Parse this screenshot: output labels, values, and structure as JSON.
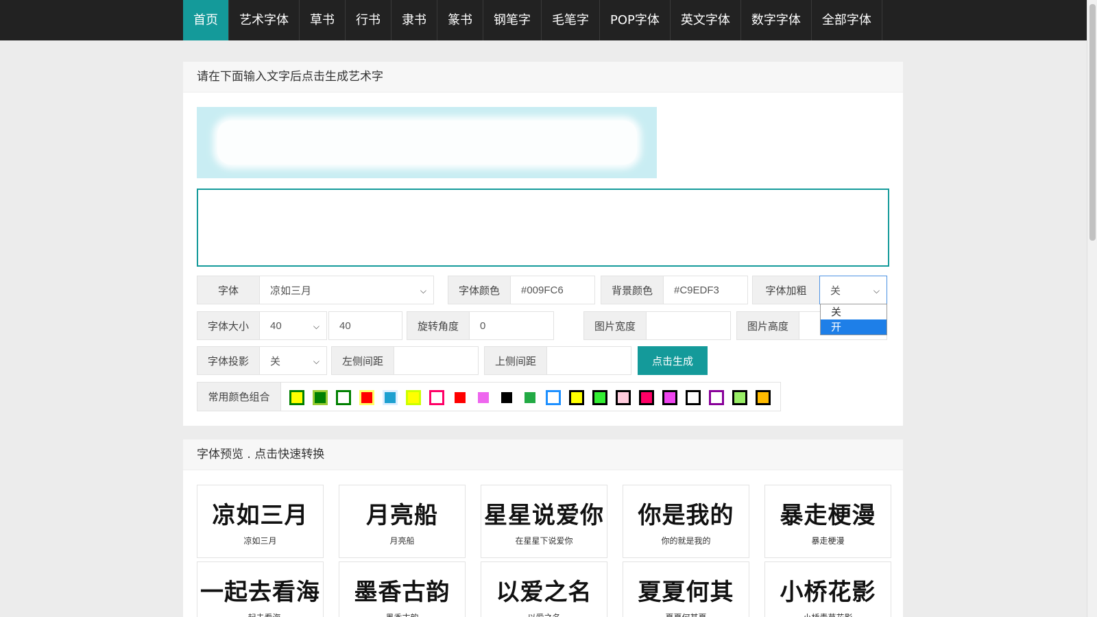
{
  "nav": {
    "items": [
      "首页",
      "艺术字体",
      "草书",
      "行书",
      "隶书",
      "篆书",
      "钢笔字",
      "毛笔字",
      "POP字体",
      "英文字体",
      "数字字体",
      "全部字体"
    ],
    "active_index": 0
  },
  "generator": {
    "heading": "请在下面输入文字后点击生成艺术字",
    "font_label": "字体",
    "font_value": "凉如三月",
    "font_color_label": "字体颜色",
    "font_color_value": "#009FC6",
    "bg_color_label": "背景颜色",
    "bg_color_value": "#C9EDF3",
    "bold_label": "字体加粗",
    "bold_value": "关",
    "bold_options": [
      "关",
      "开"
    ],
    "bold_highlighted": "开",
    "size_label": "字体大小",
    "size_select_value": "40",
    "size_input_value": "40",
    "rotate_label": "旋转角度",
    "rotate_value": "0",
    "img_width_label": "图片宽度",
    "img_width_value": "",
    "img_height_label": "图片高度",
    "img_height_value": "",
    "shadow_label": "字体投影",
    "shadow_value": "关",
    "left_margin_label": "左侧间距",
    "left_margin_value": "",
    "top_margin_label": "上侧间距",
    "top_margin_value": "",
    "generate_button": "点击生成",
    "color_combo_label": "常用颜色组合",
    "color_combos": [
      {
        "border": "#008000",
        "fill": "#ffff00"
      },
      {
        "border": "#99cc33",
        "fill": "#008000"
      },
      {
        "border": "#008000",
        "fill": "#ffffff"
      },
      {
        "border": "#ffff66",
        "fill": "#ff0000"
      },
      {
        "border": "#ddeeff",
        "fill": "#1ea0d0"
      },
      {
        "border": "#ccff00",
        "fill": "#ffff00"
      },
      {
        "border": "#ff0066",
        "fill": "#ffffff"
      },
      {
        "border": "#ffffff",
        "fill": "#ff0000"
      },
      {
        "border": "#ffffff",
        "fill": "#ee66ee"
      },
      {
        "border": "#ffffff",
        "fill": "#000000"
      },
      {
        "border": "#ffffff",
        "fill": "#22aa44"
      },
      {
        "border": "#1e90ff",
        "fill": "#ffffff"
      },
      {
        "border": "#000000",
        "fill": "#ffff00"
      },
      {
        "border": "#000000",
        "fill": "#33ee33"
      },
      {
        "border": "#000000",
        "fill": "#ffccdd"
      },
      {
        "border": "#000000",
        "fill": "#ff0066"
      },
      {
        "border": "#000000",
        "fill": "#ee44ee"
      },
      {
        "border": "#000000",
        "fill": "#ffffff"
      },
      {
        "border": "#880099",
        "fill": "#ffffff"
      },
      {
        "border": "#000000",
        "fill": "#99ee66"
      },
      {
        "border": "#000000",
        "fill": "#ffbb00"
      }
    ]
  },
  "fonts_preview": {
    "heading": "字体预览 . 点击快速转换",
    "row1": [
      {
        "art": "凉如三月",
        "caption": "凉如三月"
      },
      {
        "art": "月亮船",
        "caption": "月亮船"
      },
      {
        "art": "星星说爱你",
        "caption": "在星星下说爱你"
      },
      {
        "art": "你是我的",
        "caption": "你的就是我的"
      },
      {
        "art": "暴走梗漫",
        "caption": "暴走梗漫"
      }
    ],
    "row2": [
      {
        "art": "一起去看海",
        "caption": "一起去看海"
      },
      {
        "art": "墨香古韵",
        "caption": "墨香古韵"
      },
      {
        "art": "以爱之名",
        "caption": "以爱之名"
      },
      {
        "art": "夏夏何其",
        "caption": "夏夏何其夏"
      },
      {
        "art": "小桥花影",
        "caption": "小桥青草花影"
      }
    ]
  }
}
